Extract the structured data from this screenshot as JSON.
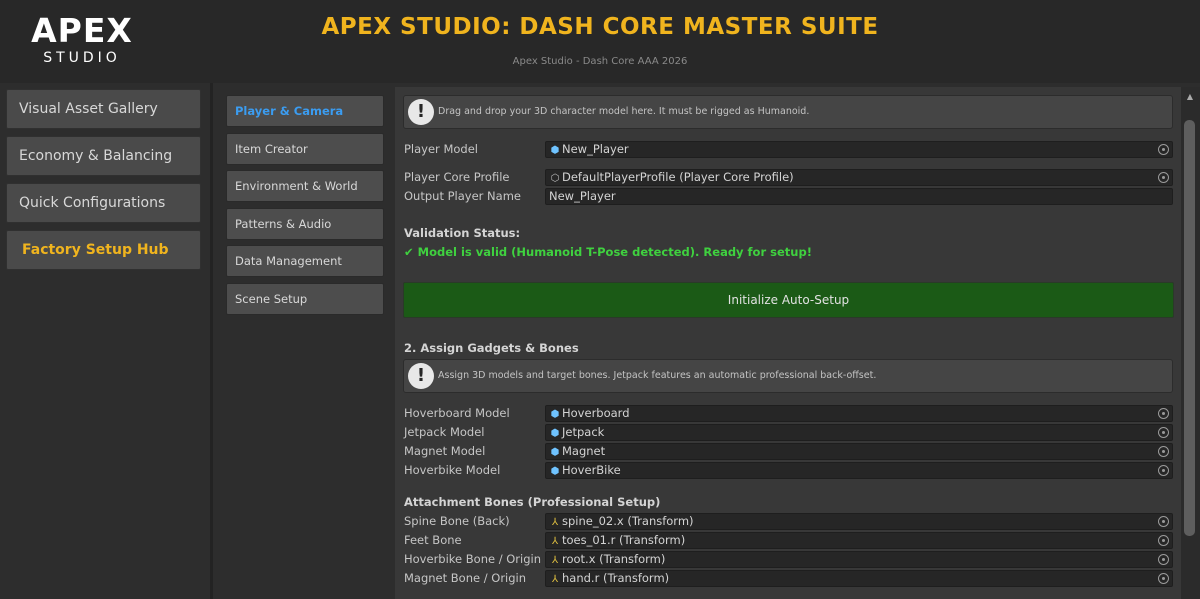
{
  "header": {
    "logo_main": "APEX",
    "logo_sub": "STUDIO",
    "title": "APEX STUDIO: DASH CORE MASTER SUITE",
    "subtitle": "Apex Studio - Dash Core AAA 2026",
    "accent_color": "#f0b41e"
  },
  "sidebar": {
    "items": [
      {
        "label": "Visual Asset Gallery"
      },
      {
        "label": "Economy & Balancing"
      },
      {
        "label": "Quick Configurations"
      },
      {
        "label": "Factory Setup Hub",
        "active": true
      }
    ]
  },
  "categories": {
    "items": [
      {
        "label": "Player & Camera",
        "active": true
      },
      {
        "label": "Item Creator"
      },
      {
        "label": "Environment & World"
      },
      {
        "label": "Patterns & Audio"
      },
      {
        "label": "Data Management"
      },
      {
        "label": "Scene Setup"
      }
    ],
    "active_color": "#3b9cf0"
  },
  "main": {
    "help1": "Drag and drop your 3D character model here. It must be rigged as Humanoid.",
    "player_fields": [
      {
        "label": "Player Model",
        "value": "New_Player",
        "icon": "cube-icon",
        "picker": true
      },
      {
        "label": "Player Core Profile",
        "value": "DefaultPlayerProfile (Player Core Profile)",
        "icon": "scriptable-object-icon",
        "picker": true
      },
      {
        "label": "Output Player Name",
        "value": "New_Player",
        "icon": "",
        "picker": false
      }
    ],
    "validation_title": "Validation Status:",
    "validation_message": "✔ Model is valid (Humanoid T-Pose detected). Ready for setup!",
    "validation_color": "#3fd13f",
    "init_button": "Initialize Auto-Setup",
    "init_button_color": "#1b5a16",
    "section2_title": "2. Assign Gadgets & Bones",
    "help2": "Assign 3D models and target bones. Jetpack features an automatic professional back-offset.",
    "gadget_fields": [
      {
        "label": "Hoverboard Model",
        "value": "Hoverboard",
        "icon": "cube-icon"
      },
      {
        "label": "Jetpack Model",
        "value": "Jetpack",
        "icon": "cube-icon"
      },
      {
        "label": "Magnet Model",
        "value": "Magnet",
        "icon": "cube-icon"
      },
      {
        "label": "Hoverbike Model",
        "value": "HoverBike",
        "icon": "cube-icon"
      }
    ],
    "bones_title": "Attachment Bones (Professional Setup)",
    "bone_fields": [
      {
        "label": "Spine Bone (Back)",
        "value": "spine_02.x (Transform)",
        "icon": "transform-icon"
      },
      {
        "label": "Feet Bone",
        "value": "toes_01.r (Transform)",
        "icon": "transform-icon"
      },
      {
        "label": "Hoverbike Bone / Origin",
        "value": "root.x (Transform)",
        "icon": "transform-icon"
      },
      {
        "label": "Magnet Bone / Origin",
        "value": "hand.r (Transform)",
        "icon": "transform-icon"
      }
    ]
  }
}
